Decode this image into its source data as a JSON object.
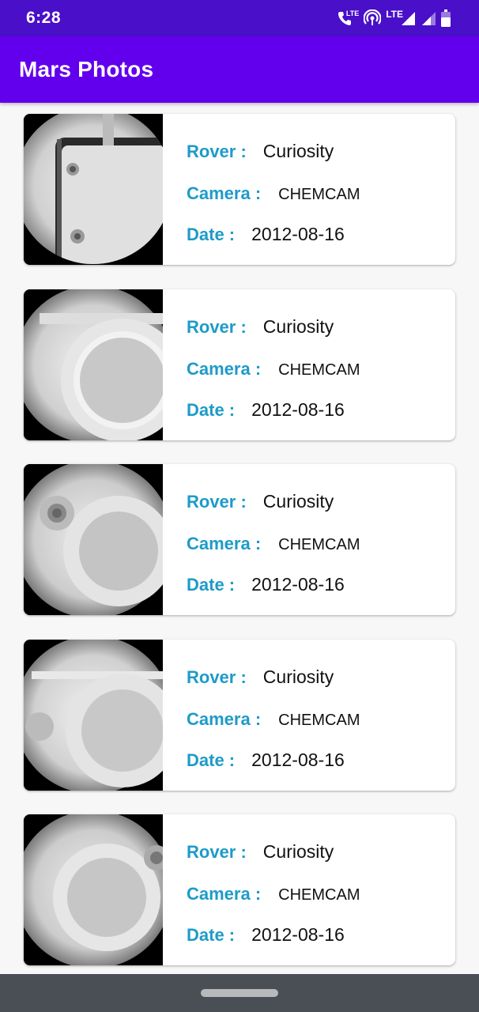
{
  "status_bar": {
    "time": "6:28",
    "icons": [
      "lte-call-icon",
      "hotspot-icon",
      "lte-signal-icon",
      "signal-icon",
      "battery-icon"
    ],
    "lte_call_label": "LTE",
    "lte_label": "LTE"
  },
  "app_bar": {
    "title": "Mars Photos"
  },
  "colors": {
    "status_bar": "#4a0fc8",
    "app_bar": "#6200ee",
    "label": "#1e9bc8",
    "background": "#f7f7f7",
    "nav_bar": "#4a4f55"
  },
  "photos": [
    {
      "rover_label": "Rover :",
      "rover": "Curiosity",
      "camera_label": "Camera :",
      "camera": "CHEMCAM",
      "date_label": "Date :",
      "date": "2012-08-16"
    },
    {
      "rover_label": "Rover :",
      "rover": "Curiosity",
      "camera_label": "Camera :",
      "camera": "CHEMCAM",
      "date_label": "Date :",
      "date": "2012-08-16"
    },
    {
      "rover_label": "Rover :",
      "rover": "Curiosity",
      "camera_label": "Camera :",
      "camera": "CHEMCAM",
      "date_label": "Date :",
      "date": "2012-08-16"
    },
    {
      "rover_label": "Rover :",
      "rover": "Curiosity",
      "camera_label": "Camera :",
      "camera": "CHEMCAM",
      "date_label": "Date :",
      "date": "2012-08-16"
    },
    {
      "rover_label": "Rover :",
      "rover": "Curiosity",
      "camera_label": "Camera :",
      "camera": "CHEMCAM",
      "date_label": "Date :",
      "date": "2012-08-16"
    }
  ]
}
